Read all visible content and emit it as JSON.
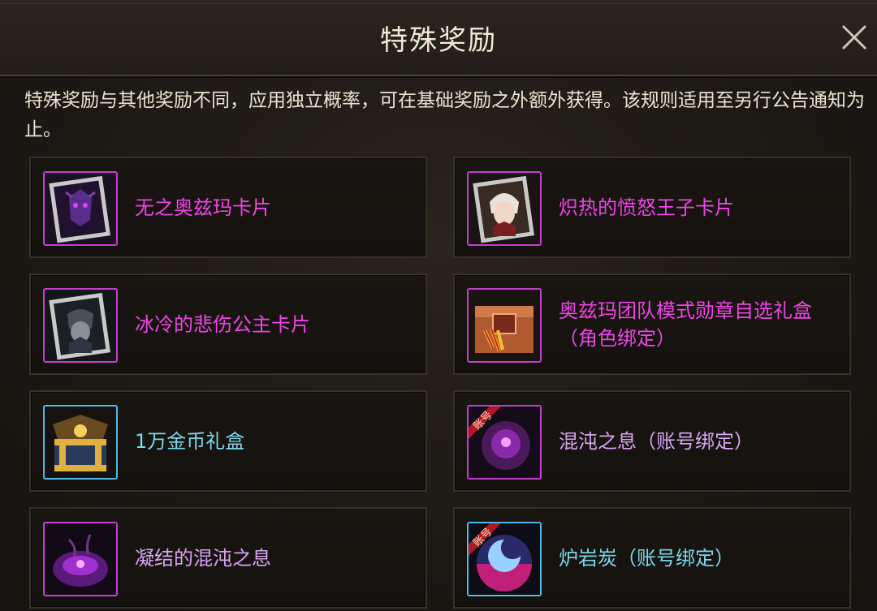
{
  "header": {
    "title": "特殊奖励"
  },
  "description": "特殊奖励与其他奖励不同，应用独立概率，可在基础奖励之外额外获得。该规则适用至另行公告通知为止。",
  "colors": {
    "magenta": "#ee45e6",
    "lavender": "#d9a4f2",
    "cyan": "#7cd8ef",
    "purple_border": "#c43fd0",
    "blue_border": "#4fb8ea"
  },
  "rewards": [
    {
      "name": "无之奥兹玛卡片",
      "icon": "ozma-card-icon"
    },
    {
      "name": "炽热的愤怒王子卡片",
      "icon": "prince-card-icon"
    },
    {
      "name": "冰冷的悲伤公主卡片",
      "icon": "princess-card-icon"
    },
    {
      "name": "奥兹玛团队模式勋章自选礼盒\n（角色绑定）",
      "icon": "medal-box-icon"
    },
    {
      "name": "1万金币礼盒",
      "icon": "gold-chest-icon"
    },
    {
      "name": "混沌之息（账号绑定）",
      "icon": "chaos-breath-icon",
      "badge": "账号"
    },
    {
      "name": "凝结的混沌之息",
      "icon": "condensed-chaos-icon"
    },
    {
      "name": "炉岩炭（账号绑定）",
      "icon": "furnace-stone-icon",
      "badge": "账号"
    }
  ]
}
